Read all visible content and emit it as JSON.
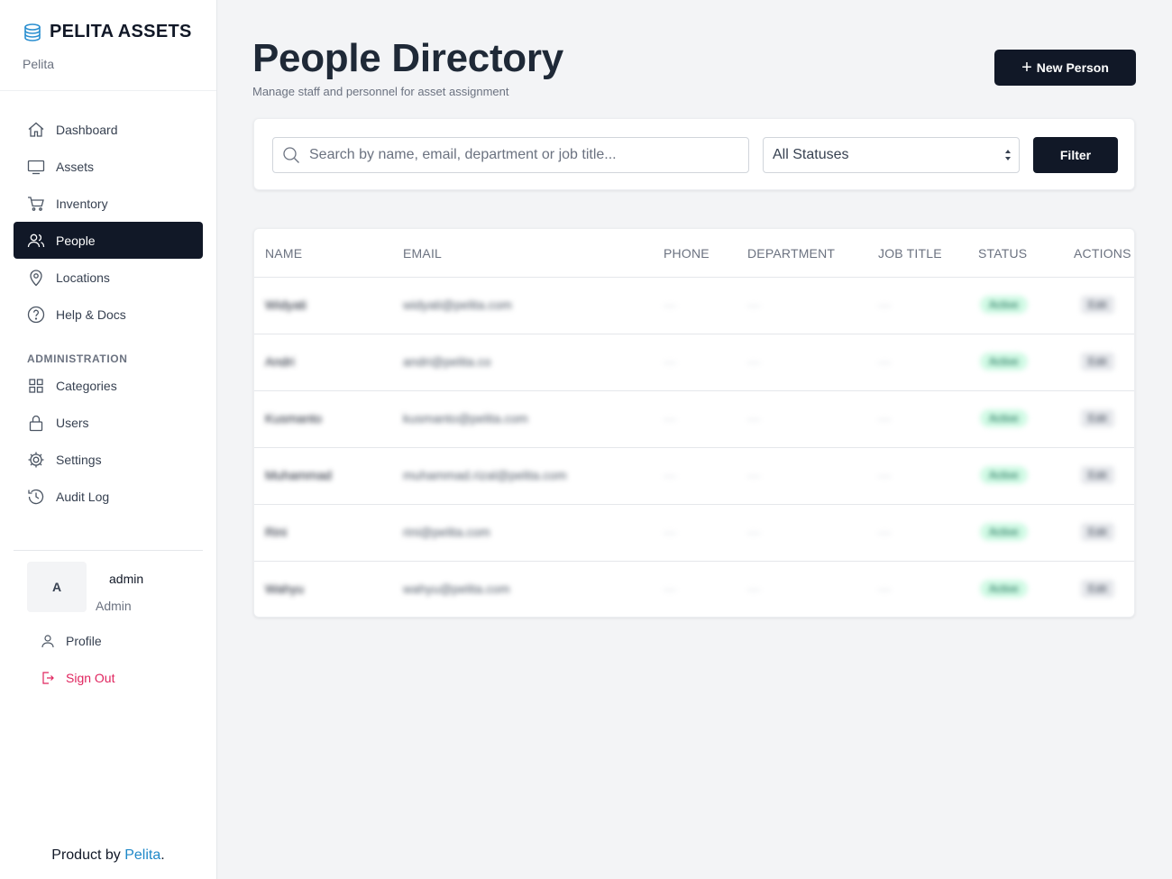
{
  "brand": {
    "title": "PELITA ASSETS",
    "subtitle": "Pelita"
  },
  "nav": {
    "items": [
      {
        "label": "Dashboard",
        "icon": "home-icon"
      },
      {
        "label": "Assets",
        "icon": "monitor-icon"
      },
      {
        "label": "Inventory",
        "icon": "cart-icon"
      },
      {
        "label": "People",
        "icon": "users-icon",
        "active": true
      },
      {
        "label": "Locations",
        "icon": "map-pin-icon"
      },
      {
        "label": "Help & Docs",
        "icon": "help-icon"
      }
    ],
    "admin_section": "ADMINISTRATION",
    "admin_items": [
      {
        "label": "Categories",
        "icon": "grid-icon"
      },
      {
        "label": "Users",
        "icon": "lock-icon"
      },
      {
        "label": "Settings",
        "icon": "gear-icon"
      },
      {
        "label": "Audit Log",
        "icon": "history-icon"
      }
    ]
  },
  "user": {
    "initial": "A",
    "name": "admin",
    "role": "Admin",
    "profile_label": "Profile",
    "signout_label": "Sign Out"
  },
  "footer": {
    "prefix": "Product by ",
    "brand": "Pelita",
    "suffix": "."
  },
  "header": {
    "title": "People Directory",
    "subtitle": "Manage staff and personnel for asset assignment",
    "new_button": "New Person"
  },
  "filters": {
    "search_placeholder": "Search by name, email, department or job title...",
    "status_value": "All Statuses",
    "filter_button": "Filter"
  },
  "table": {
    "columns": [
      "NAME",
      "EMAIL",
      "PHONE",
      "DEPARTMENT",
      "JOB TITLE",
      "STATUS",
      "ACTIONS"
    ],
    "rows": [
      {
        "name": "Widyati",
        "email": "widyati@pelita.com",
        "phone": "—",
        "department": "—",
        "job_title": "—",
        "status": "Active",
        "action": "Edit"
      },
      {
        "name": "Andri",
        "email": "andri@pelita.co",
        "phone": "—",
        "department": "—",
        "job_title": "—",
        "status": "Active",
        "action": "Edit"
      },
      {
        "name": "Kusmanto",
        "email": "kusmanto@pelita.com",
        "phone": "—",
        "department": "—",
        "job_title": "—",
        "status": "Active",
        "action": "Edit"
      },
      {
        "name": "Muhammad",
        "email": "muhammad.rizal@pelita.com",
        "phone": "—",
        "department": "—",
        "job_title": "—",
        "status": "Active",
        "action": "Edit"
      },
      {
        "name": "Rini",
        "email": "rini@pelita.com",
        "phone": "—",
        "department": "—",
        "job_title": "—",
        "status": "Active",
        "action": "Edit"
      },
      {
        "name": "Wahyu",
        "email": "wahyu@pelita.com",
        "phone": "—",
        "department": "—",
        "job_title": "—",
        "status": "Active",
        "action": "Edit"
      }
    ]
  },
  "colors": {
    "accent": "#111827",
    "brand_link": "#1e88c8",
    "signout": "#e0245e",
    "status_bg": "#d1fae5"
  }
}
